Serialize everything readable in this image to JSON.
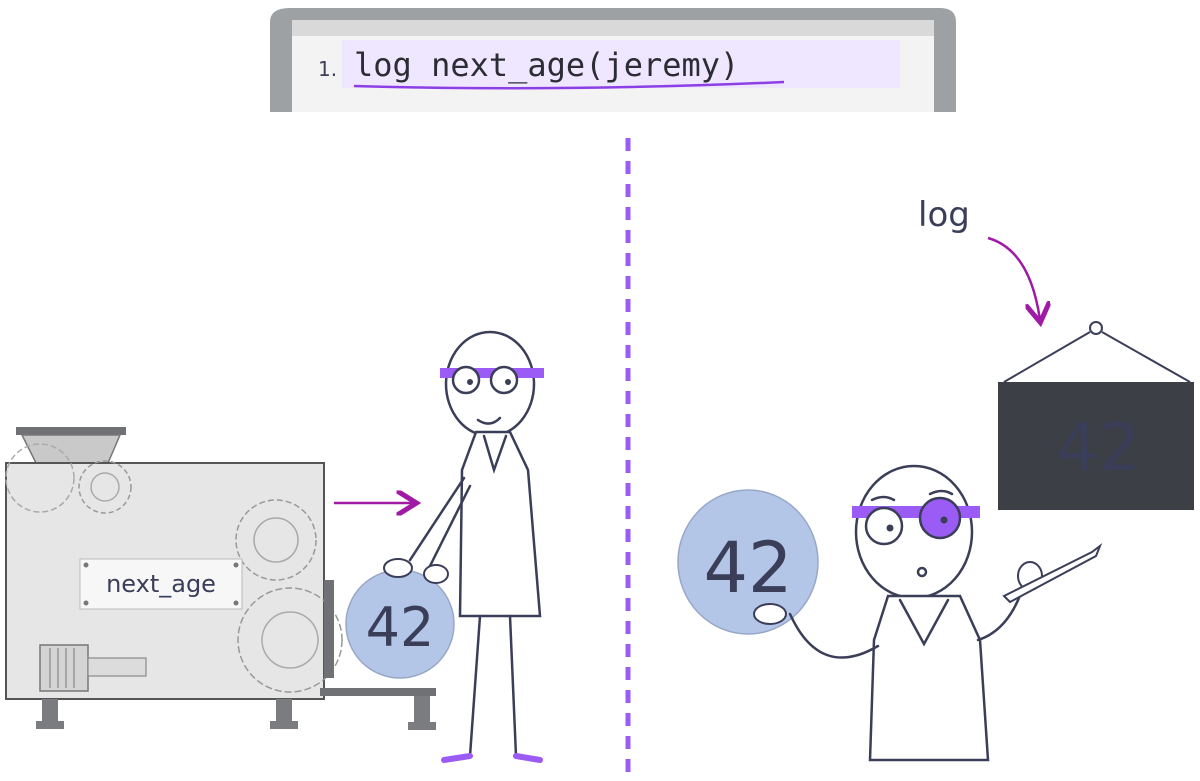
{
  "code_panel": {
    "line_number": "1.",
    "code": "log next_age(jeremy)"
  },
  "machine": {
    "label": "next_age"
  },
  "left_scene": {
    "value": "42"
  },
  "right_scene": {
    "held_value": "42",
    "log_label": "log",
    "board_value": "42"
  },
  "colors": {
    "accent": "#9b5cf6",
    "arrow": "#a01aa6",
    "highlight": "#efe6ff",
    "ball": "#b4c6e8",
    "ink": "#3b3e58",
    "board": "#3d3f46"
  }
}
